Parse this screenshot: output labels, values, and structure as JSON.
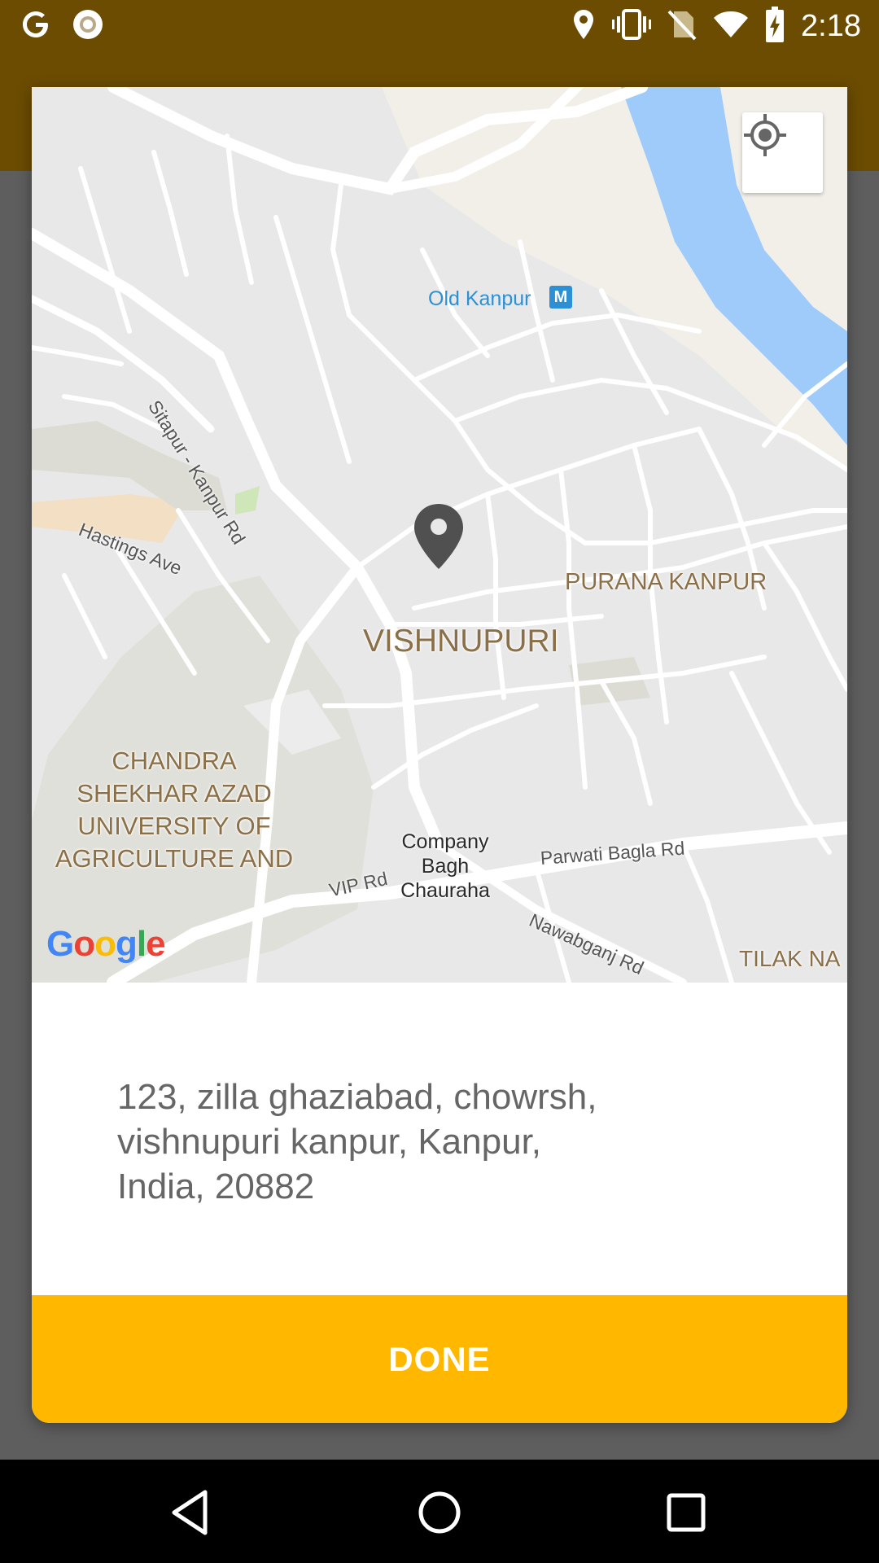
{
  "status_bar": {
    "time": "2:18",
    "left_icons": [
      "google-icon",
      "circle-notification-icon"
    ],
    "right_icons": [
      "location-icon",
      "vibrate-icon",
      "no-sim-icon",
      "wifi-icon",
      "battery-charging-icon"
    ]
  },
  "map": {
    "labels": {
      "old_kanpur": "Old Kanpur",
      "metro_badge": "M",
      "sitapur_rd": "Sitapur - Kanpur Rd",
      "hastings_ave": "Hastings Ave",
      "purana_kanpur": "PURANA KANPUR",
      "vishnupuri": "VISHNUPURI",
      "university_line1": "CHANDRA",
      "university_line2": "SHEKHAR AZAD",
      "university_line3": "UNIVERSITY OF",
      "university_line4": "AGRICULTURE AND",
      "company_bagh_line1": "Company",
      "company_bagh_line2": "Bagh",
      "company_bagh_line3": "Chauraha",
      "vip_rd": "VIP Rd",
      "parwati_bagla_rd": "Parwati Bagla Rd",
      "nawabganj_rd": "Nawabganj Rd",
      "tilak_na": "TILAK NA"
    },
    "google_logo": [
      "G",
      "o",
      "o",
      "g",
      "l",
      "e"
    ],
    "colors": {
      "water": "#9fcbfb",
      "land": "#e8e8e8",
      "park": "#dcdcd4",
      "road": "#ffffff",
      "pin": "#505050"
    }
  },
  "dialog": {
    "address_line1": "123, zilla ghaziabad, chowrsh,",
    "address_line2": "vishnupuri kanpur, Kanpur,",
    "address_line3": "India, 20882",
    "done_label": "DONE"
  },
  "colors": {
    "accent": "#ffb700",
    "status_bar": "#6b4c00"
  }
}
